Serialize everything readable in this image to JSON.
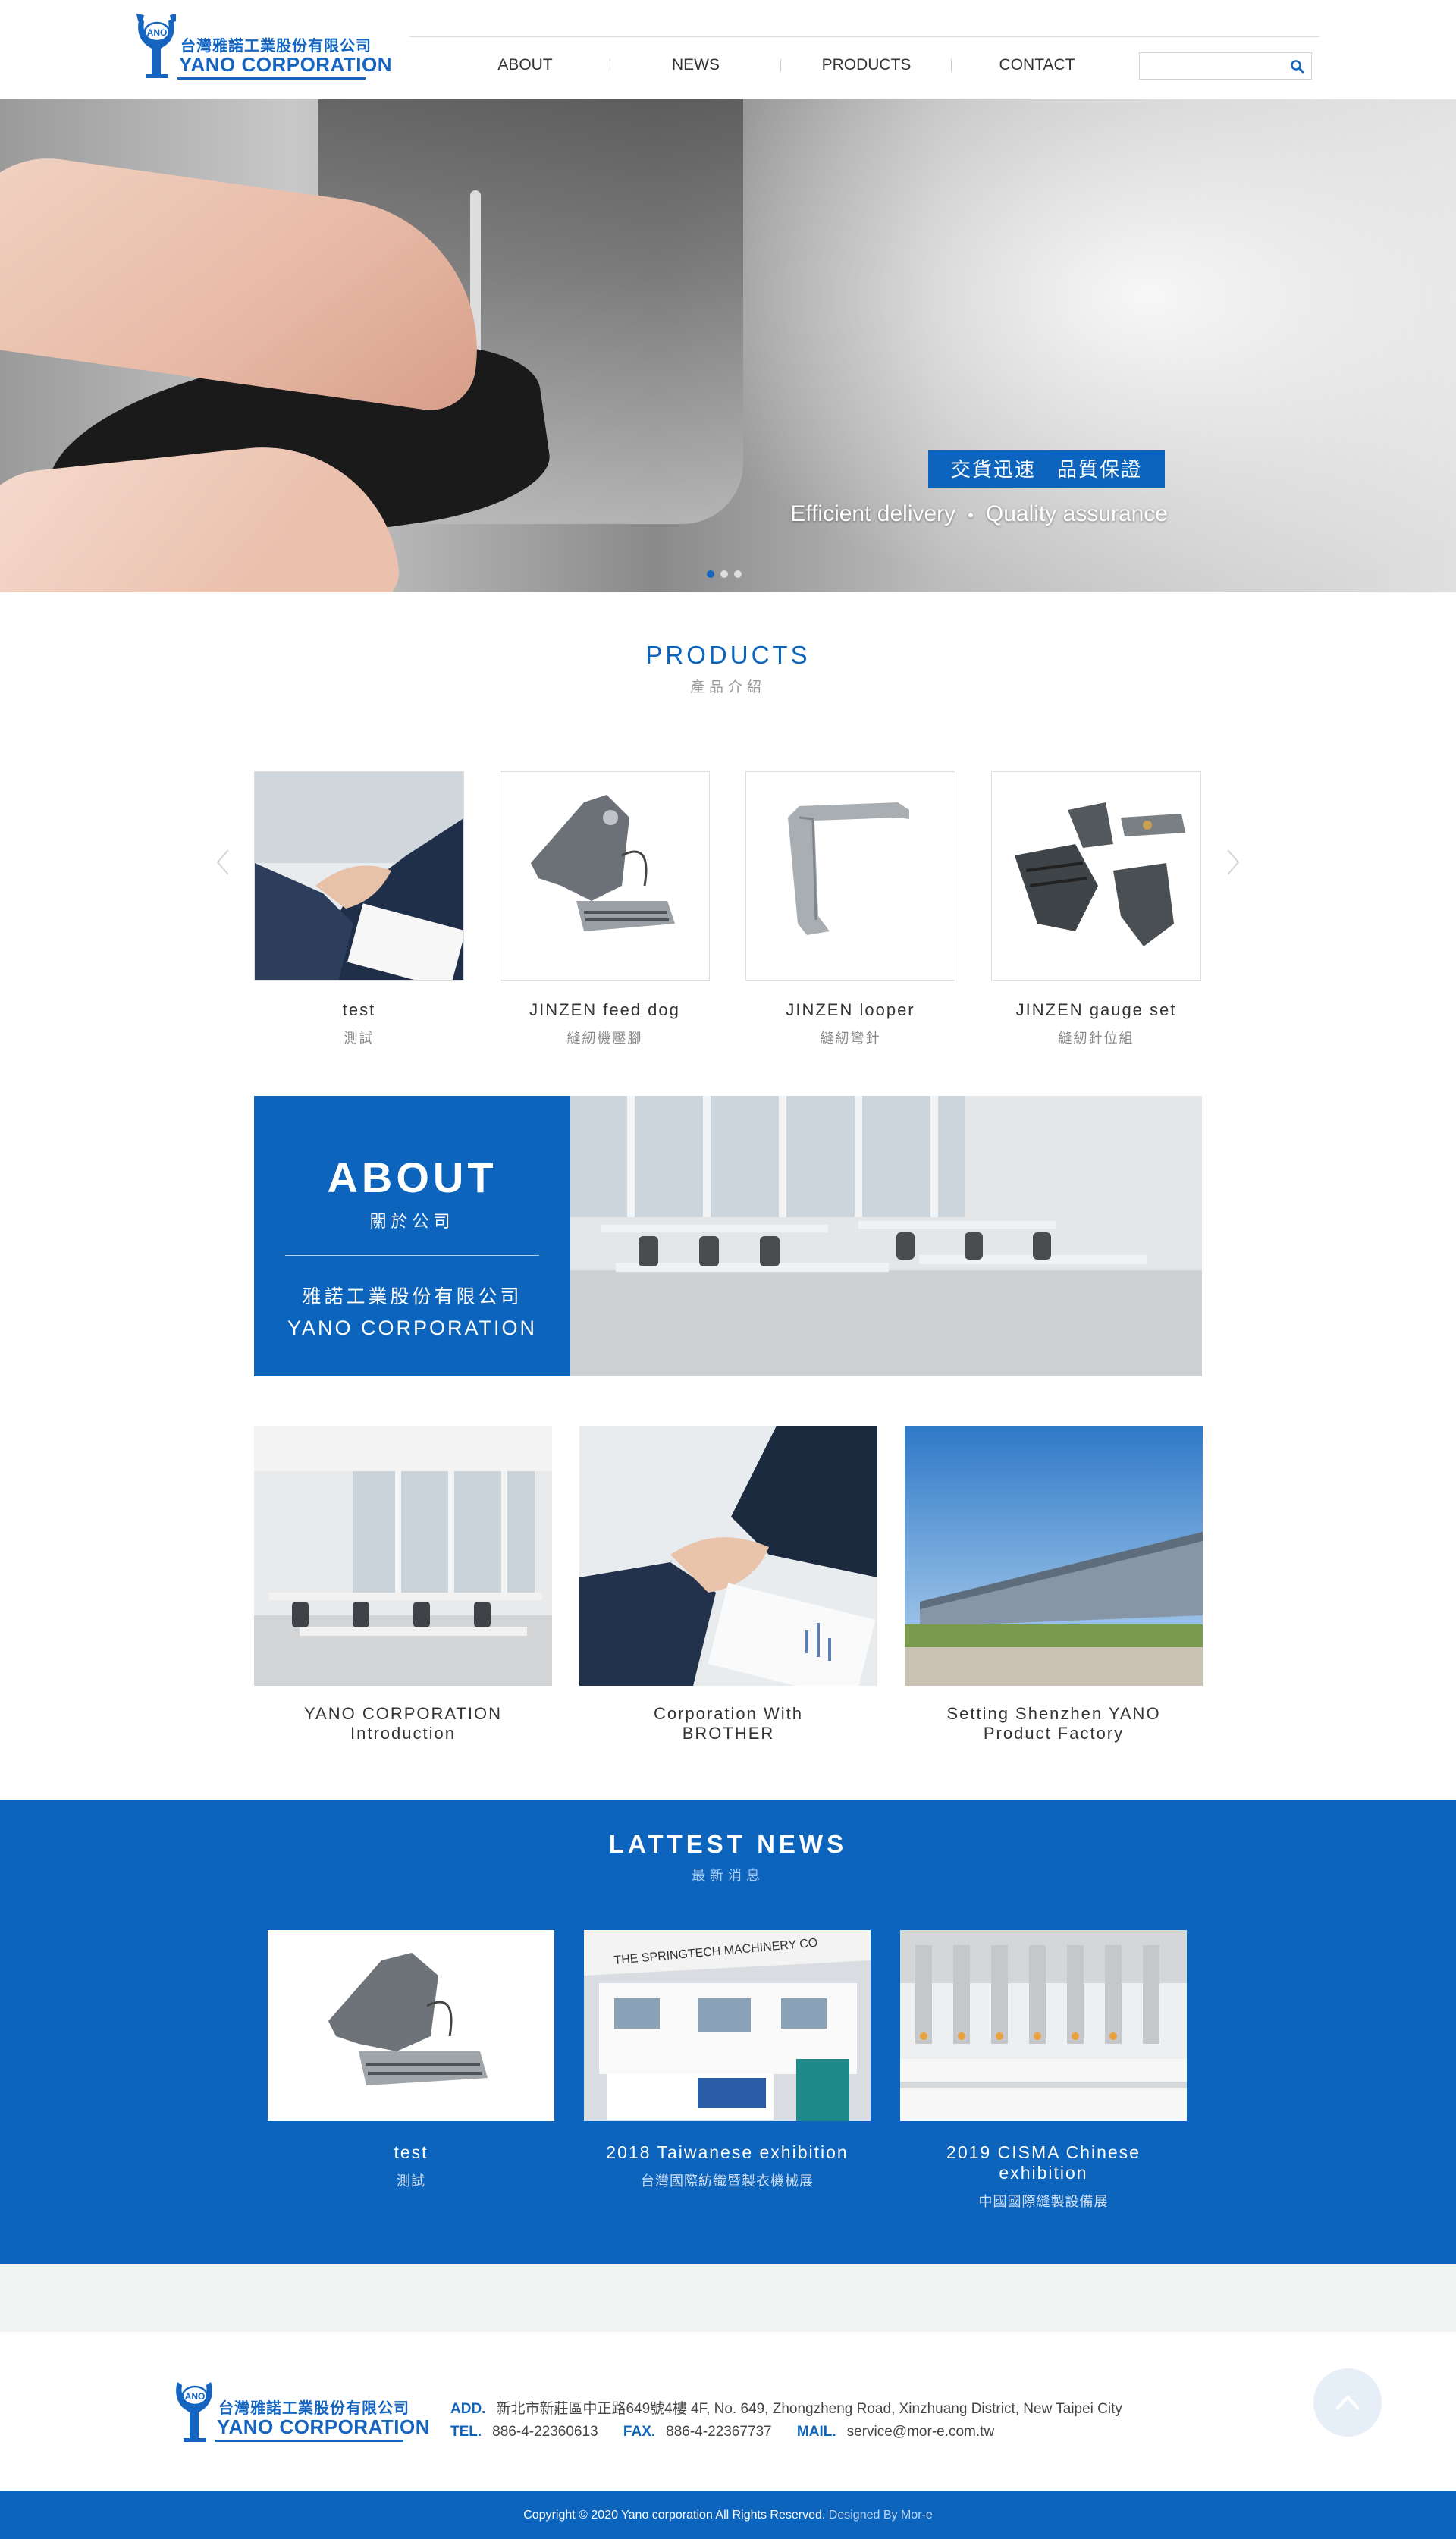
{
  "brand": {
    "name_zh": "台灣雅諾工業股份有限公司",
    "name_en": "YANO CORPORATION",
    "mark": "ANO",
    "accent": "#0c64bd"
  },
  "nav": {
    "items": [
      {
        "label": "ABOUT"
      },
      {
        "label": "NEWS"
      },
      {
        "label": "PRODUCTS"
      },
      {
        "label": "CONTACT"
      }
    ],
    "search_placeholder": "",
    "search_icon": "search-icon"
  },
  "hero": {
    "tag": "交貨迅速　品質保證",
    "caption_left": "Efficient delivery",
    "caption_sep": "•",
    "caption_right": "Quality assurance",
    "slide_count": 3,
    "active_slide": 1
  },
  "products": {
    "title_en": "PRODUCTS",
    "title_zh": "產品介紹",
    "items": [
      {
        "name": "test",
        "sub": "測試"
      },
      {
        "name": "JINZEN feed dog",
        "sub": "縫紉機壓腳"
      },
      {
        "name": "JINZEN looper",
        "sub": "縫紉彎針"
      },
      {
        "name": "JINZEN gauge set",
        "sub": "縫紉針位組"
      }
    ]
  },
  "about": {
    "title": "ABOUT",
    "title_zh": "關於公司",
    "company_zh": "雅諾工業股份有限公司",
    "company_en": "YANO CORPORATION"
  },
  "highlights": [
    {
      "line1": "YANO CORPORATION",
      "line2": "Introduction"
    },
    {
      "line1": "Corporation With",
      "line2": "BROTHER"
    },
    {
      "line1": "Setting Shenzhen YANO",
      "line2": "Product Factory"
    }
  ],
  "news": {
    "title_en": "LATTEST NEWS",
    "title_zh": "最新消息",
    "items": [
      {
        "name": "test",
        "sub": "測試"
      },
      {
        "name": "2018 Taiwanese exhibition",
        "sub": "台灣國際紡織暨製衣機械展",
        "banner": "THE SPRINGTECH MACHINERY CO"
      },
      {
        "name": "2019 CISMA Chinese exhibition",
        "sub": "中國國際縫製設備展"
      }
    ]
  },
  "footer": {
    "add_label": "ADD.",
    "add_value": "新北市新莊區中正路649號4樓 4F, No. 649, Zhongzheng Road, Xinzhuang District, New Taipei City",
    "tel_label": "TEL.",
    "tel_value": "886-4-22360613",
    "fax_label": "FAX.",
    "fax_value": "886-4-22367737",
    "mail_label": "MAIL.",
    "mail_value": "service@mor-e.com.tw",
    "copyright": "Copyright © 2020 Yano corporation All Rights Reserved.",
    "designed_by": "Designed By Mor-e"
  }
}
